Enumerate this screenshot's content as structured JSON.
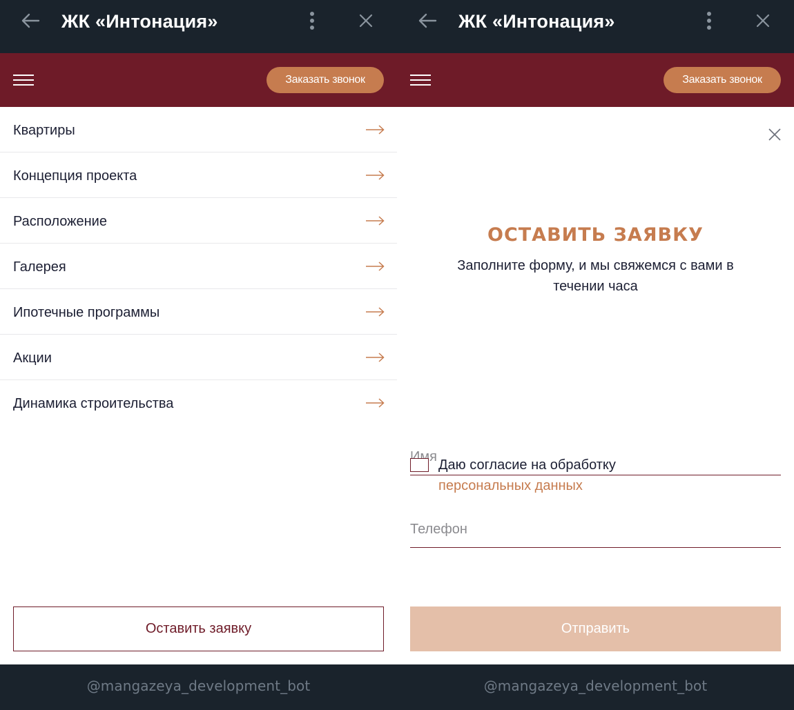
{
  "telegram": {
    "title": "ЖК «Интонация»",
    "bot_handle": "@mangazeya_development_bot"
  },
  "site": {
    "callback_label": "Заказать звонок"
  },
  "menu": {
    "items": [
      {
        "label": "Квартиры"
      },
      {
        "label": "Концепция проекта"
      },
      {
        "label": "Расположение"
      },
      {
        "label": "Галерея"
      },
      {
        "label": "Ипотечные программы"
      },
      {
        "label": "Акции"
      },
      {
        "label": "Динамика строительства"
      }
    ],
    "request_label": "Оставить заявку"
  },
  "form": {
    "title": "ОСТАВИТЬ ЗАЯВКУ",
    "subtitle": "Заполните форму, и мы свяжемся с вами в течении часа",
    "name_placeholder": "Имя",
    "phone_placeholder": "Телефон",
    "consent_text": "Даю согласие на обработку",
    "consent_link": "персональных данных",
    "submit_label": "Отправить"
  },
  "colors": {
    "telegram_bg": "#1a232c",
    "brand_burgundy": "#6e1b28",
    "accent_copper": "#c67c4f",
    "submit_disabled": "#e4bfa9"
  }
}
